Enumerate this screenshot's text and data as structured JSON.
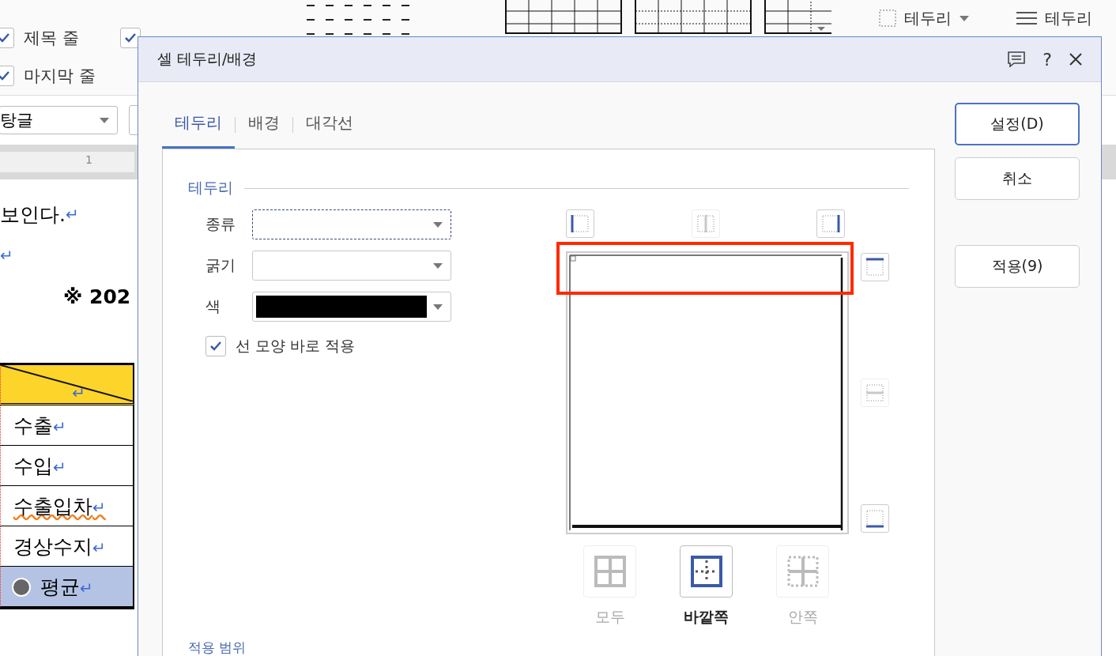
{
  "ribbon": {
    "options": [
      {
        "label": "제목 줄",
        "checked": true
      },
      {
        "label": "마지막 줄",
        "checked": true
      },
      {
        "checked": true
      }
    ],
    "border_button": {
      "label": "테두리"
    },
    "line_button": {
      "label": "테두리"
    },
    "style_dropdown": {
      "value": "탕글"
    }
  },
  "ruler": {
    "label": "1"
  },
  "document": {
    "paragraphs": [
      {
        "text": "보인다.",
        "mark": "↵"
      },
      {
        "mark": "↵"
      },
      {
        "text": "※  202"
      }
    ],
    "table": {
      "rows": [
        {
          "kind": "header",
          "text": "",
          "mark": "↵",
          "selected": false,
          "misspelled": false
        },
        {
          "kind": "data",
          "text": "수출",
          "mark": "↵",
          "selected": false,
          "misspelled": false
        },
        {
          "kind": "data",
          "text": "수입",
          "mark": "↵",
          "selected": false,
          "misspelled": false
        },
        {
          "kind": "data",
          "text": "수출입차",
          "mark": "↵",
          "selected": false,
          "misspelled": true
        },
        {
          "kind": "data",
          "text": "경상수지",
          "mark": "↵",
          "selected": false,
          "misspelled": false
        },
        {
          "kind": "total",
          "text": "평균",
          "mark": "↵",
          "selected": true,
          "misspelled": false
        }
      ]
    }
  },
  "dialog": {
    "title": "셀 테두리/배경",
    "help": "?",
    "tabs": [
      {
        "label": "테두리",
        "selected": true
      },
      {
        "label": "배경",
        "selected": false
      },
      {
        "label": "대각선",
        "selected": false
      }
    ],
    "section": "테두리",
    "fields": [
      {
        "kind": "select",
        "label": "종류",
        "focused": true
      },
      {
        "kind": "select",
        "label": "굵기",
        "focused": false
      },
      {
        "kind": "color",
        "label": "색",
        "color": "#000000",
        "focused": false
      }
    ],
    "apply_now": {
      "label": "선 모양 바로 적용",
      "checked": true
    },
    "edge_buttons_top": [
      {
        "kind": "left",
        "disabled": false
      },
      {
        "kind": "vertical",
        "disabled": true
      },
      {
        "kind": "right",
        "disabled": false
      }
    ],
    "edge_buttons_side": [
      {
        "kind": "top",
        "disabled": false
      },
      {
        "kind": "horizontal",
        "disabled": true
      },
      {
        "kind": "bottom",
        "disabled": false
      }
    ],
    "highlight": true,
    "presets": [
      {
        "kind": "all",
        "label": "모두",
        "disabled": true,
        "selected": false
      },
      {
        "kind": "outside",
        "label": "바깥쪽",
        "disabled": false,
        "selected": true
      },
      {
        "kind": "inside",
        "label": "안쪽",
        "disabled": true,
        "selected": false
      }
    ],
    "buttons": [
      {
        "label": "설정(D)",
        "primary": true
      },
      {
        "label": "취소",
        "primary": false
      },
      {
        "label": "적용(9)",
        "primary": false
      }
    ],
    "next_section": "적용 범위"
  }
}
